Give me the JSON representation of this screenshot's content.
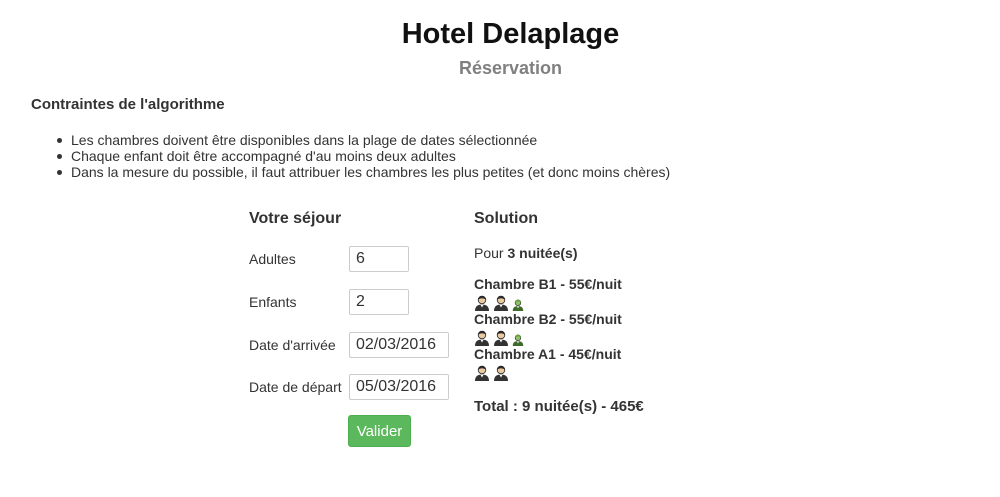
{
  "header": {
    "title": "Hotel Delaplage",
    "subtitle": "Réservation"
  },
  "constraints": {
    "heading": "Contraintes de l'algorithme",
    "items": [
      "Les chambres doivent être disponibles dans la plage de dates sélectionnée",
      "Chaque enfant doit être accompagné d'au moins deux adultes",
      "Dans la mesure du possible, il faut attribuer les chambres les plus petites (et donc moins chères)"
    ]
  },
  "form": {
    "heading": "Votre séjour",
    "adults_label": "Adultes",
    "adults_value": "6",
    "children_label": "Enfants",
    "children_value": "2",
    "arrival_label": "Date d'arrivée",
    "arrival_value": "02/03/2016",
    "departure_label": "Date de départ",
    "departure_value": "05/03/2016",
    "submit_label": "Valider"
  },
  "solution": {
    "heading": "Solution",
    "nights_prefix": "Pour ",
    "nights_value": "3 nuitée(s)",
    "rooms": [
      {
        "title": "Chambre B1 - 55€/nuit",
        "adults": 2,
        "children": 1
      },
      {
        "title": "Chambre B2 - 55€/nuit",
        "adults": 2,
        "children": 1
      },
      {
        "title": "Chambre A1 - 45€/nuit",
        "adults": 2,
        "children": 0
      }
    ],
    "total": "Total : 9 nuitée(s) - 465€"
  },
  "icons": {
    "adult": "adult-person-icon",
    "child": "child-person-icon"
  },
  "colors": {
    "button": "#5cb85c",
    "subtitle": "#808080",
    "child_icon": "#8fc36a",
    "adult_icon": "#333333"
  }
}
